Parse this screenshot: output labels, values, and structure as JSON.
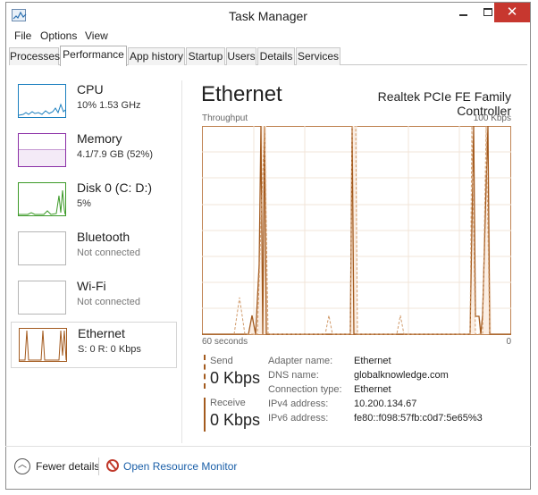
{
  "window": {
    "title": "Task Manager",
    "close": "✕"
  },
  "menu": [
    "File",
    "Options",
    "View"
  ],
  "tabs": [
    "Processes",
    "Performance",
    "App history",
    "Startup",
    "Users",
    "Details",
    "Services"
  ],
  "active_tab": "Performance",
  "sidebar": [
    {
      "name": "CPU",
      "sub": "10%  1.53 GHz",
      "color": "#1b7fbf"
    },
    {
      "name": "Memory",
      "sub": "4.1/7.9 GB (52%)",
      "color": "#8b2fa6"
    },
    {
      "name": "Disk 0 (C: D:)",
      "sub": "5%",
      "color": "#3c9a28"
    },
    {
      "name": "Bluetooth",
      "sub": "Not connected",
      "color": "#999999"
    },
    {
      "name": "Wi-Fi",
      "sub": "Not connected",
      "color": "#999999"
    },
    {
      "name": "Ethernet",
      "sub": "S: 0  R: 0 Kbps",
      "color": "#a35a1e"
    }
  ],
  "main": {
    "title": "Ethernet",
    "adapter": "Realtek PCIe FE Family Controller",
    "graph_label_left": "Throughput",
    "graph_label_right": "100 Kbps",
    "axis_left": "60 seconds",
    "axis_right": "0",
    "send_label": "Send",
    "send_value": "0 Kbps",
    "receive_label": "Receive",
    "receive_value": "0 Kbps",
    "details": [
      {
        "key": "Adapter name:",
        "value": "Ethernet"
      },
      {
        "key": "DNS name:",
        "value": "globalknowledge.com"
      },
      {
        "key": "Connection type:",
        "value": "Ethernet"
      },
      {
        "key": "IPv4 address:",
        "value": "10.200.134.67"
      },
      {
        "key": "IPv6 address:",
        "value": "fe80::f098:57fb:c0d7:5e65%3"
      }
    ]
  },
  "footer": {
    "fewer_details": "Fewer details",
    "open_resource_monitor": "Open Resource Monitor"
  },
  "colors": {
    "accent_ethernet": "#a35a1e",
    "close_button": "#c7372f",
    "link": "#1a5fa8"
  }
}
